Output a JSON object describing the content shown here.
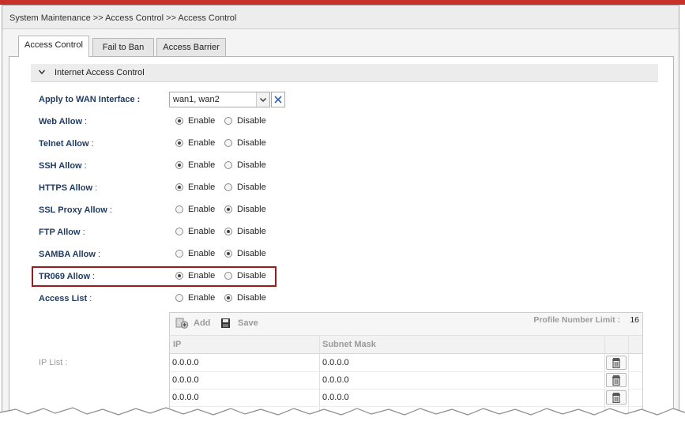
{
  "breadcrumb": "System Maintenance >> Access Control >> Access Control",
  "tabs": [
    {
      "label": "Access Control",
      "active": true
    },
    {
      "label": "Fail to Ban",
      "active": false
    },
    {
      "label": "Access Barrier",
      "active": false
    }
  ],
  "section": {
    "title": "Internet Access Control",
    "icon": "chevron-down-icon"
  },
  "wan": {
    "label": "Apply to WAN Interface",
    "colon": " :",
    "value": "wan1, wan2"
  },
  "radio_labels": {
    "enable": "Enable",
    "disable": "Disable"
  },
  "settings": [
    {
      "label": "Web Allow",
      "colon": " :",
      "value": "Enable"
    },
    {
      "label": "Telnet Allow",
      "colon": " :",
      "value": "Enable"
    },
    {
      "label": "SSH Allow",
      "colon": " :",
      "value": "Enable"
    },
    {
      "label": "HTTPS Allow",
      "colon": " :",
      "value": "Enable"
    },
    {
      "label": "SSL Proxy Allow",
      "colon": " :",
      "value": "Disable"
    },
    {
      "label": "FTP Allow",
      "colon": " :",
      "value": "Disable"
    },
    {
      "label": "SAMBA Allow",
      "colon": " :",
      "value": "Disable"
    },
    {
      "label": "TR069 Allow",
      "colon": " :",
      "value": "Enable"
    },
    {
      "label": "Access List",
      "colon": " :",
      "value": "Disable"
    }
  ],
  "ip_list": {
    "label": "IP List",
    "colon": " :",
    "toolbar": {
      "add_label": "Add",
      "save_label": "Save"
    },
    "limit_label": "Profile Number Limit :",
    "limit_value": "16",
    "columns": [
      "IP",
      "Subnet Mask"
    ],
    "rows": [
      {
        "ip": "0.0.0.0",
        "mask": "0.0.0.0"
      },
      {
        "ip": "0.0.0.0",
        "mask": "0.0.0.0"
      },
      {
        "ip": "0.0.0.0",
        "mask": "0.0.0.0"
      }
    ]
  },
  "colors": {
    "accent_red": "#c7312b",
    "highlight_border": "#9b1b1b",
    "label_blue": "#1f3a5f"
  }
}
